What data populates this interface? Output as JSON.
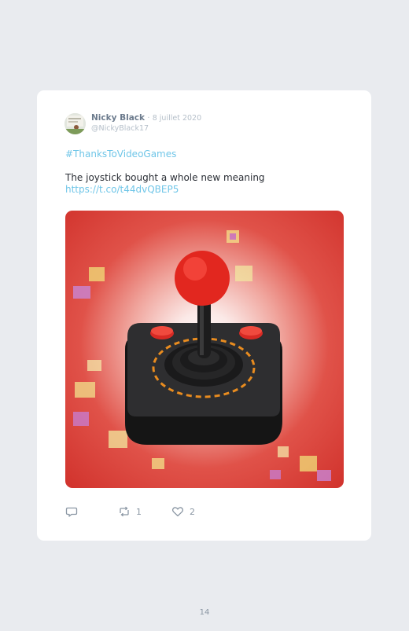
{
  "tweet": {
    "author_name": "Nicky Black",
    "separator": "·",
    "date": "8 juillet 2020",
    "handle": "@NickyBlack17",
    "hashtag": "#ThanksToVideoGames",
    "text": "The joystick bought a whole new meaning",
    "link": "https://t.co/t44dvQBEP5",
    "media_description_icon": "joystick-image",
    "actions": {
      "reply_count": "",
      "retweet_count": "1",
      "like_count": "2"
    }
  },
  "page": {
    "number": "14"
  },
  "colors": {
    "background": "#e9ebef",
    "card": "#ffffff",
    "link": "#70c6e8",
    "name": "#6c7b8d",
    "meta": "#b5bfc9",
    "icon": "#8a96a3"
  }
}
